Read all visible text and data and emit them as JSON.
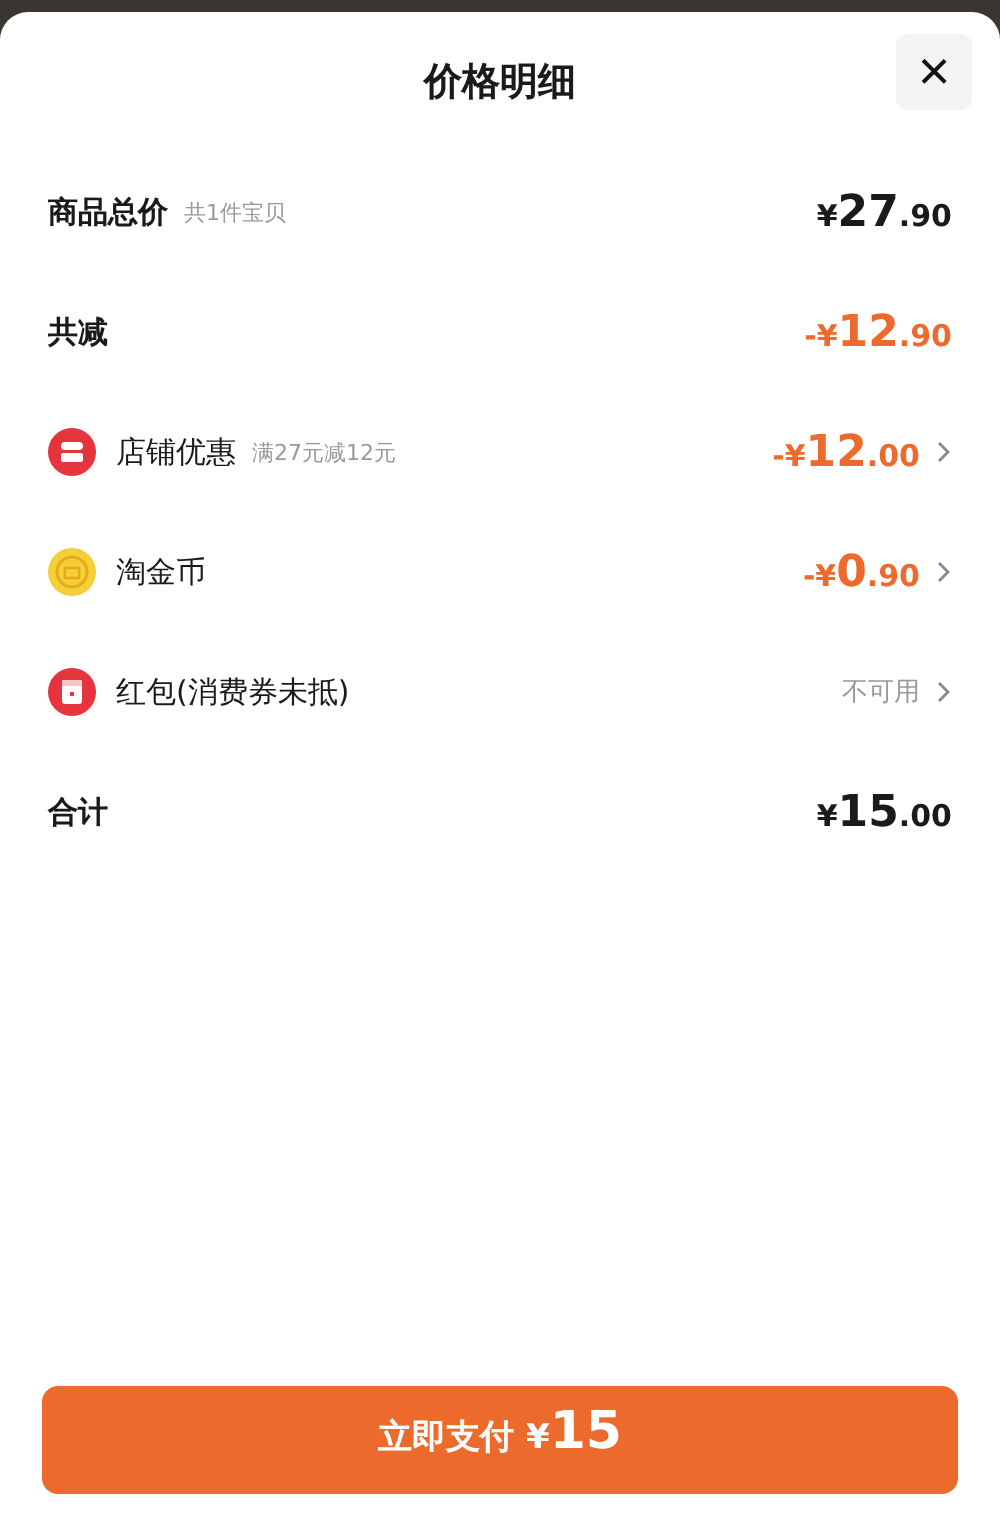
{
  "sheet": {
    "title": "价格明细",
    "close": "×"
  },
  "rows": [
    {
      "kind": "total",
      "label": "商品总价",
      "note": "共1件宝贝",
      "prefix": "¥",
      "integer": "27",
      "decimal": ".90"
    },
    {
      "kind": "reduction",
      "label": "共减",
      "prefix": "-¥",
      "integer": "12",
      "decimal": ".90"
    },
    {
      "kind": "discount",
      "label": "店铺优惠",
      "note": "满27元减12元",
      "prefix": "-¥",
      "integer": "12",
      "decimal": ".00"
    },
    {
      "kind": "discount",
      "label": "淘金币",
      "prefix": "-¥",
      "integer": "0",
      "decimal": ".90"
    },
    {
      "kind": "unavailable",
      "label": "红包(消费券未抵)",
      "status": "不可用"
    },
    {
      "kind": "total",
      "label": "合计",
      "prefix": "¥",
      "integer": "15",
      "decimal": ".00"
    }
  ],
  "pay_button": {
    "label": "立即支付",
    "prefix": "¥",
    "amount": "15"
  }
}
